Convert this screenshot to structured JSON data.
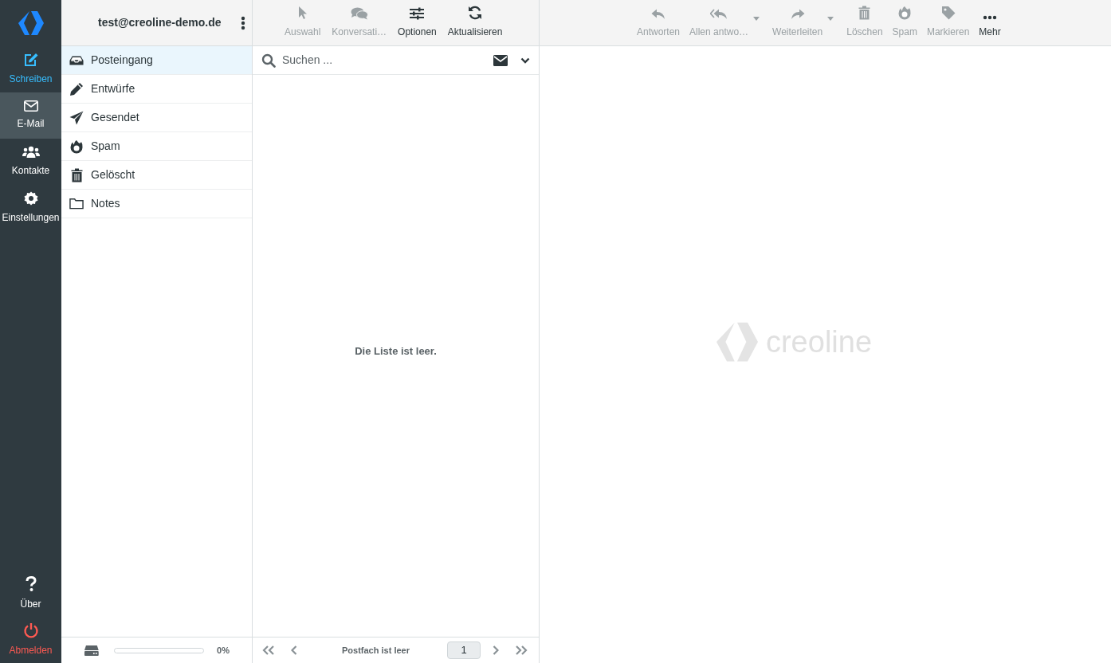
{
  "nav": {
    "items": [
      {
        "label": "Schreiben",
        "kind": "compose",
        "selected": false
      },
      {
        "label": "E-Mail",
        "kind": "mail",
        "selected": true
      },
      {
        "label": "Kontakte",
        "kind": "contacts",
        "selected": false
      },
      {
        "label": "Einstellungen",
        "kind": "settings",
        "selected": false
      }
    ],
    "bottom_items": [
      {
        "label": "Über",
        "kind": "about"
      },
      {
        "label": "Abmelden",
        "kind": "logout"
      }
    ]
  },
  "account": {
    "email": "test@creoline-demo.de"
  },
  "folders": [
    {
      "label": "Posteingang",
      "kind": "inbox",
      "selected": true
    },
    {
      "label": "Entwürfe",
      "kind": "drafts",
      "selected": false
    },
    {
      "label": "Gesendet",
      "kind": "sent",
      "selected": false
    },
    {
      "label": "Spam",
      "kind": "spam",
      "selected": false
    },
    {
      "label": "Gelöscht",
      "kind": "trash",
      "selected": false
    },
    {
      "label": "Notes",
      "kind": "folder",
      "selected": false
    }
  ],
  "quota": {
    "level": 0,
    "reading": "0%"
  },
  "list_toolbar": [
    {
      "label": "Auswahl",
      "kind": "select",
      "disabled": true
    },
    {
      "label": "Konversati…",
      "kind": "threads",
      "disabled": true
    },
    {
      "label": "Optionen",
      "kind": "options",
      "disabled": false
    },
    {
      "label": "Aktualisieren",
      "kind": "refresh",
      "disabled": false
    }
  ],
  "search": {
    "placeholder": "Suchen ..."
  },
  "message_list": {
    "empty_text": "Die Liste ist leer."
  },
  "pagination": {
    "status": "Postfach ist leer",
    "page": "1"
  },
  "message_toolbar": [
    {
      "label": "Antworten",
      "kind": "reply",
      "disabled": true,
      "has_menu": false
    },
    {
      "label": "Allen antwo…",
      "kind": "reply-all",
      "disabled": true,
      "has_menu": true
    },
    {
      "label": "Weiterleiten",
      "kind": "forward",
      "disabled": true,
      "has_menu": true
    },
    {
      "label": "Löschen",
      "kind": "trash",
      "disabled": true,
      "has_menu": false
    },
    {
      "label": "Spam",
      "kind": "spam",
      "disabled": true,
      "has_menu": false
    },
    {
      "label": "Markieren",
      "kind": "tag",
      "disabled": true,
      "has_menu": false
    },
    {
      "label": "Mehr",
      "kind": "more",
      "disabled": false,
      "has_menu": false
    }
  ],
  "watermark": {
    "text": "creoline"
  }
}
